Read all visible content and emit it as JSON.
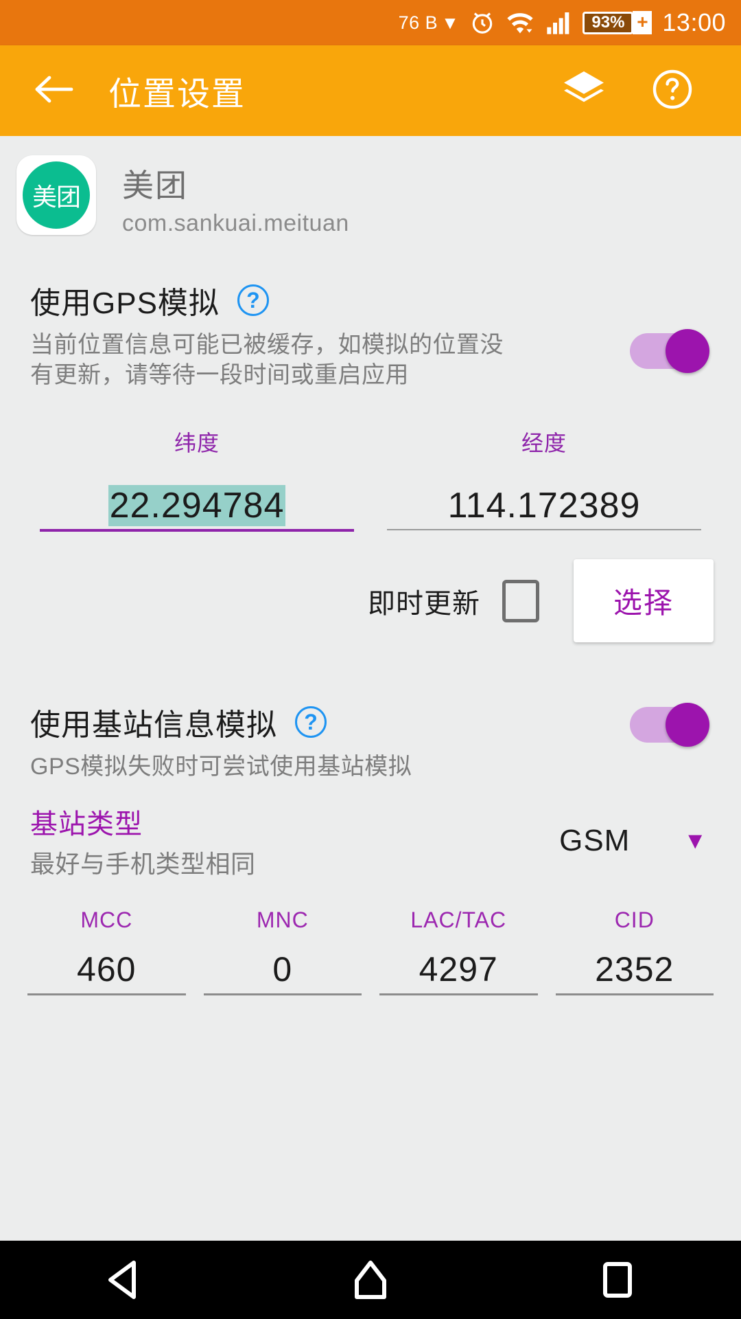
{
  "statusbar": {
    "network_speed": "76 B",
    "network_caret": "▼",
    "battery_percent": "93%",
    "battery_plus": "+",
    "time": "13:00",
    "icons": [
      "alarm-clock-icon",
      "wifi-icon",
      "signal-icon",
      "battery-icon"
    ]
  },
  "appbar": {
    "back_icon": "back-arrow-icon",
    "title": "位置设置",
    "layers_icon": "layers-icon",
    "help_icon": "help-circle-icon"
  },
  "app": {
    "icon_text": "美团",
    "name": "美团",
    "package": "com.sankuai.meituan",
    "icon_color": "#0bbd90"
  },
  "gps_section": {
    "title": "使用GPS模拟",
    "help": "?",
    "description": "当前位置信息可能已被缓存，如模拟的位置没有更新，请等待一段时间或重启应用",
    "toggle_on": true,
    "latitude_label": "纬度",
    "latitude_value": "22.294784",
    "longitude_label": "经度",
    "longitude_value": "114.172389",
    "instant_update_label": "即时更新",
    "instant_update_checked": false,
    "select_button": "选择",
    "selection_highlight_color": "#96d0c9",
    "accent_color": "#9c14ad"
  },
  "cell_section": {
    "title": "使用基站信息模拟",
    "help": "?",
    "description": "GPS模拟失败时可尝试使用基站模拟",
    "toggle_on": true,
    "type_title": "基站类型",
    "type_sub": "最好与手机类型相同",
    "type_value": "GSM",
    "type_caret": "▼",
    "fields": [
      {
        "label": "MCC",
        "value": "460"
      },
      {
        "label": "MNC",
        "value": "0"
      },
      {
        "label": "LAC/TAC",
        "value": "4297"
      },
      {
        "label": "CID",
        "value": "2352"
      }
    ]
  },
  "navbar": {
    "back_icon": "nav-back-triangle-icon",
    "home_icon": "nav-home-icon",
    "recents_icon": "nav-recents-icon"
  }
}
